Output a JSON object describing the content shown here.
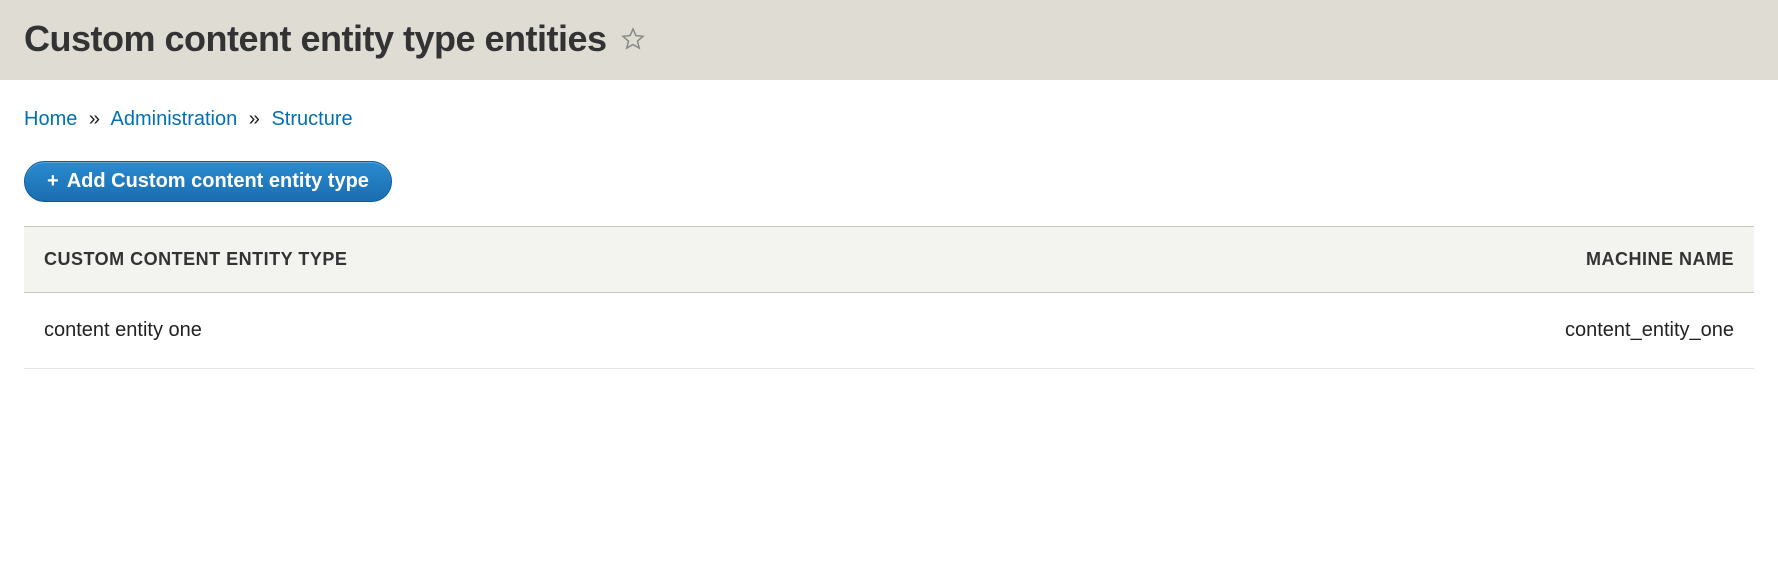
{
  "header": {
    "title": "Custom content entity type entities"
  },
  "breadcrumb": {
    "home": "Home",
    "admin": "Administration",
    "structure": "Structure",
    "sep": "»"
  },
  "actions": {
    "add_label": "Add Custom content entity type"
  },
  "table": {
    "columns": {
      "type": "Custom content entity type",
      "machine": "Machine name"
    },
    "rows": [
      {
        "type": "content entity one",
        "machine": "content_entity_one"
      }
    ]
  }
}
